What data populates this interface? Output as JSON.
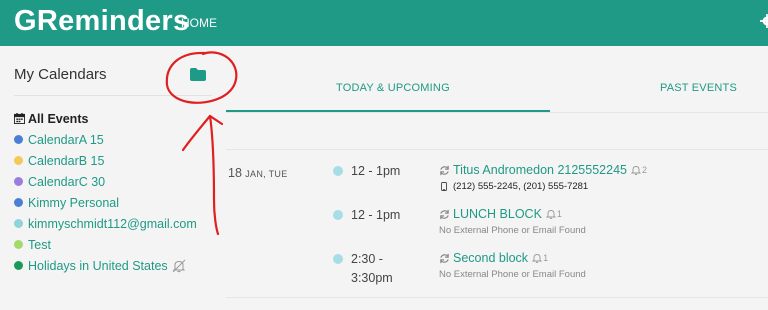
{
  "header": {
    "brand": "GReminders",
    "nav_home": "HOME",
    "background_color": "#1f9a86"
  },
  "sidebar": {
    "title": "My Calendars",
    "all_events_label": "All Events",
    "calendars": [
      {
        "label": "CalendarA 15",
        "color": "#4a7fd8"
      },
      {
        "label": "CalendarB 15",
        "color": "#f3c95b"
      },
      {
        "label": "CalendarC 30",
        "color": "#9d7ce0"
      },
      {
        "label": "Kimmy Personal",
        "color": "#4a7fd8"
      },
      {
        "label": "kimmyschmidt112@gmail.com",
        "color": "#8fd3db"
      },
      {
        "label": "Test",
        "color": "#a5d96b"
      },
      {
        "label": "Holidays in United States",
        "color": "#1a9a5a",
        "muted": true
      }
    ]
  },
  "tabs": {
    "today_upcoming": "TODAY & UPCOMING",
    "past_events": "PAST EVENTS",
    "active": "today_upcoming"
  },
  "day": {
    "day_num": "18",
    "month_weekday": "JAN, TUE"
  },
  "events": [
    {
      "time_line1": "12 - 1pm",
      "time_line2": "",
      "title": "Titus Andromedon 2125552245",
      "reminder_count": "2",
      "detail": "(212) 555-2245, (201) 555-7281",
      "detail_is_phone": true
    },
    {
      "time_line1": "12 - 1pm",
      "time_line2": "",
      "title": "LUNCH BLOCK",
      "reminder_count": "1",
      "detail": "No External Phone or Email Found",
      "detail_is_phone": false
    },
    {
      "time_line1": "2:30 -",
      "time_line2": "3:30pm",
      "title": "Second block",
      "reminder_count": "1",
      "detail": "No External Phone or Email Found",
      "detail_is_phone": false
    }
  ],
  "icons": {
    "gear": "gear-icon",
    "folder": "folder-icon",
    "calendar": "calendar-icon",
    "sync": "sync-icon",
    "bell": "bell-icon",
    "bell_off": "bell-off-icon",
    "phone": "phone-icon"
  }
}
